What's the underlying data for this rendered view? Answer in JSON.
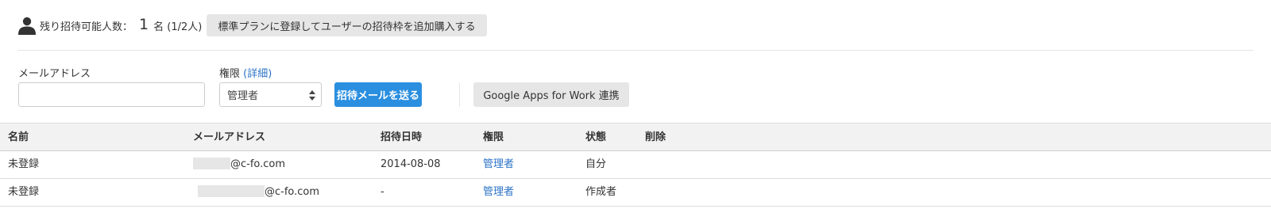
{
  "quota": {
    "label": "残り招待可能人数：",
    "count": "1",
    "unit": "名 (1/2人)",
    "upgrade_button": "標準プランに登録してユーザーの招待枠を追加購入する",
    "icon": "user-icon"
  },
  "form": {
    "email_label": "メールアドレス",
    "email_value": "",
    "permission_label": "権限",
    "details_link": "(詳細)",
    "permission_selected": "管理者",
    "send_button": "招待メールを送る",
    "google_button": "Google Apps for Work 連携"
  },
  "table": {
    "columns": [
      "名前",
      "メールアドレス",
      "招待日時",
      "権限",
      "状態",
      "削除"
    ],
    "rows": [
      {
        "name": "未登録",
        "email_domain": "@c-fo.com",
        "date": "2014-08-08",
        "permission": "管理者",
        "state": "自分"
      },
      {
        "name": "未登録",
        "email_domain": "@c-fo.com",
        "date": "-",
        "permission": "管理者",
        "state": "作成者"
      }
    ]
  },
  "colors": {
    "accent": "#2b8fe0",
    "link": "#2a72c6",
    "header_bg": "#f2f2f2",
    "button_gray": "#e6e6e6"
  }
}
